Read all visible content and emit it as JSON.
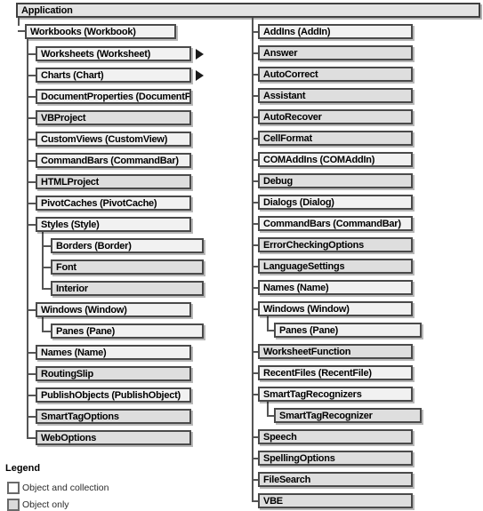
{
  "diagram": {
    "title": "Application",
    "root": {
      "label": "Application",
      "type": "object"
    },
    "left_column": {
      "parent": {
        "label": "Workbooks (Workbook)",
        "type": "collection"
      },
      "items": [
        {
          "label": "Worksheets (Worksheet)",
          "type": "collection",
          "has_arrow": true,
          "indent": 0
        },
        {
          "label": "Charts (Chart)",
          "type": "collection",
          "has_arrow": true,
          "indent": 0
        },
        {
          "label": "DocumentProperties (DocumentProperty)",
          "type": "collection",
          "has_arrow": false,
          "indent": 0
        },
        {
          "label": "VBProject",
          "type": "object",
          "has_arrow": false,
          "indent": 0
        },
        {
          "label": "CustomViews (CustomView)",
          "type": "collection",
          "has_arrow": false,
          "indent": 0
        },
        {
          "label": "CommandBars (CommandBar)",
          "type": "collection",
          "has_arrow": false,
          "indent": 0
        },
        {
          "label": "HTMLProject",
          "type": "object",
          "has_arrow": false,
          "indent": 0
        },
        {
          "label": "PivotCaches (PivotCache)",
          "type": "collection",
          "has_arrow": false,
          "indent": 0
        },
        {
          "label": "Styles (Style)",
          "type": "collection",
          "has_arrow": false,
          "indent": 0
        },
        {
          "label": "Borders (Border)",
          "type": "collection",
          "has_arrow": false,
          "indent": 1
        },
        {
          "label": "Font",
          "type": "object",
          "has_arrow": false,
          "indent": 1
        },
        {
          "label": "Interior",
          "type": "object",
          "has_arrow": false,
          "indent": 1
        },
        {
          "label": "Windows (Window)",
          "type": "collection",
          "has_arrow": false,
          "indent": 0
        },
        {
          "label": "Panes (Pane)",
          "type": "collection",
          "has_arrow": false,
          "indent": 1
        },
        {
          "label": "Names (Name)",
          "type": "collection",
          "has_arrow": false,
          "indent": 0
        },
        {
          "label": "RoutingSlip",
          "type": "object",
          "has_arrow": false,
          "indent": 0
        },
        {
          "label": "PublishObjects (PublishObject)",
          "type": "collection",
          "has_arrow": false,
          "indent": 0
        },
        {
          "label": "SmartTagOptions",
          "type": "object",
          "has_arrow": false,
          "indent": 0
        },
        {
          "label": "WebOptions",
          "type": "object",
          "has_arrow": false,
          "indent": 0
        }
      ]
    },
    "right_column": {
      "items": [
        {
          "label": "AddIns (AddIn)",
          "type": "collection",
          "indent": 0
        },
        {
          "label": "Answer",
          "type": "object",
          "indent": 0
        },
        {
          "label": "AutoCorrect",
          "type": "object",
          "indent": 0
        },
        {
          "label": "Assistant",
          "type": "object",
          "indent": 0
        },
        {
          "label": "AutoRecover",
          "type": "object",
          "indent": 0
        },
        {
          "label": "CellFormat",
          "type": "object",
          "indent": 0
        },
        {
          "label": "COMAddIns (COMAddIn)",
          "type": "collection",
          "indent": 0
        },
        {
          "label": "Debug",
          "type": "object",
          "indent": 0
        },
        {
          "label": "Dialogs (Dialog)",
          "type": "collection",
          "indent": 0
        },
        {
          "label": "CommandBars (CommandBar)",
          "type": "collection",
          "indent": 0
        },
        {
          "label": "ErrorCheckingOptions",
          "type": "object",
          "indent": 0
        },
        {
          "label": "LanguageSettings",
          "type": "object",
          "indent": 0
        },
        {
          "label": "Names (Name)",
          "type": "collection",
          "indent": 0
        },
        {
          "label": "Windows (Window)",
          "type": "collection",
          "indent": 0
        },
        {
          "label": "Panes (Pane)",
          "type": "collection",
          "indent": 1
        },
        {
          "label": "WorksheetFunction",
          "type": "object",
          "indent": 0
        },
        {
          "label": "RecentFiles (RecentFile)",
          "type": "collection",
          "indent": 0
        },
        {
          "label": "SmartTagRecognizers",
          "type": "collection",
          "indent": 0
        },
        {
          "label": "SmartTagRecognizer",
          "type": "object",
          "indent": 1
        },
        {
          "label": "Speech",
          "type": "object",
          "indent": 0
        },
        {
          "label": "SpellingOptions",
          "type": "object",
          "indent": 0
        },
        {
          "label": "FileSearch",
          "type": "object",
          "indent": 0
        },
        {
          "label": "VBE",
          "type": "object",
          "indent": 0
        }
      ]
    }
  },
  "legend": {
    "title": "Legend",
    "entries": [
      {
        "label": "Object and collection",
        "type": "collection"
      },
      {
        "label": "Object only",
        "type": "object"
      }
    ]
  },
  "colors": {
    "border": "#4a4a4a",
    "collection_fill": "#f1f1f1",
    "object_fill": "#dedede",
    "line": "#555555",
    "text": "#000000"
  }
}
